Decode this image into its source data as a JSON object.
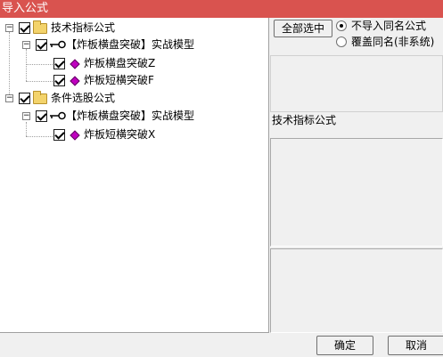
{
  "window": {
    "title": "导入公式"
  },
  "tree": {
    "group1": {
      "label": "技术指标公式",
      "child": {
        "label": "【炸板横盘突破】实战模型",
        "items": [
          "炸板横盘突破Z",
          "炸板短横突破F"
        ]
      }
    },
    "group2": {
      "label": "条件选股公式",
      "child": {
        "label": "【炸板横盘突破】实战模型",
        "items": [
          "炸板短横突破X"
        ]
      }
    }
  },
  "options": {
    "select_all": "全部选中",
    "radio1": "不导入同名公式",
    "radio2": "覆盖同名(非系统)"
  },
  "detail": {
    "type_label": "技术指标公式"
  },
  "buttons": {
    "ok": "确定",
    "cancel": "取消"
  }
}
